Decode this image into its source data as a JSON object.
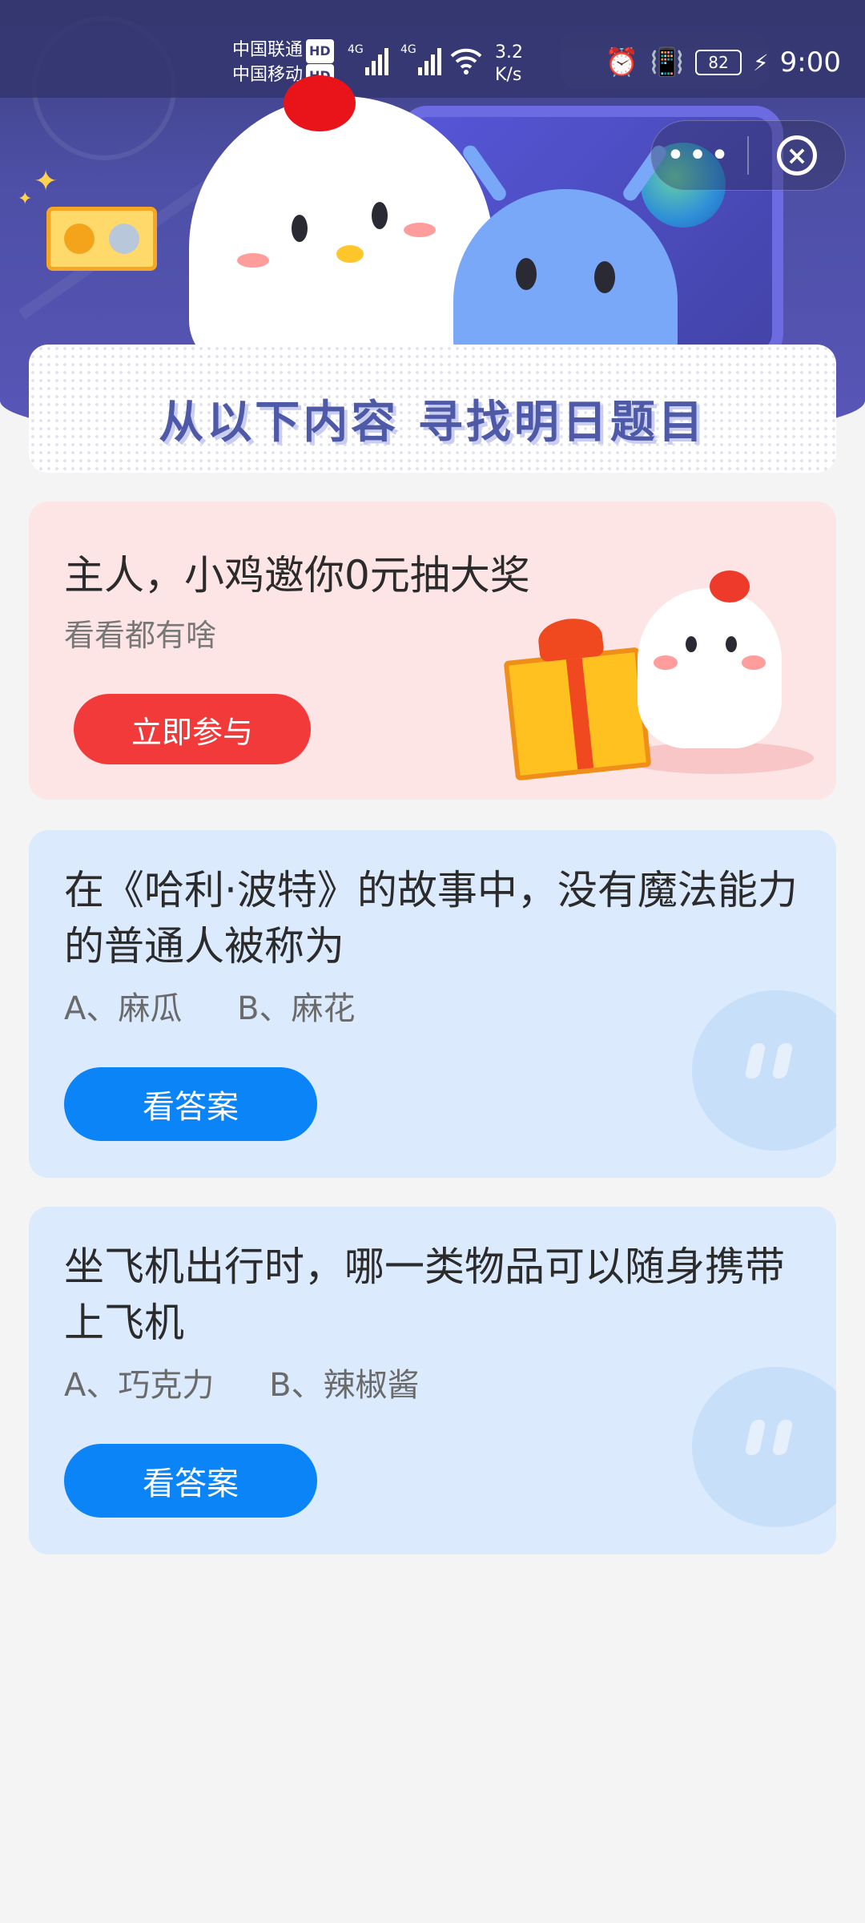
{
  "status_bar": {
    "carrier1": "中国联通",
    "carrier2": "中国移动",
    "hd": "HD",
    "net_type": "4G",
    "speed_value": "3.2",
    "speed_unit": "K/s",
    "battery": "82",
    "time": "9:00"
  },
  "header": {
    "banner_title": "从以下内容 寻找明日题目"
  },
  "promo": {
    "title": "主人，小鸡邀你0元抽大奖",
    "subtitle": "看看都有啥",
    "button_label": "立即参与"
  },
  "quiz_cards": [
    {
      "question": "在《哈利·波特》的故事中，没有魔法能力的普通人被称为",
      "option_a": "A、麻瓜",
      "option_b": "B、麻花",
      "button_label": "看答案"
    },
    {
      "question": "坐飞机出行时，哪一类物品可以随身携带上飞机",
      "option_a": "A、巧克力",
      "option_b": "B、辣椒酱",
      "button_label": "看答案"
    }
  ],
  "colors": {
    "header_bg": "#4d4fa6",
    "promo_bg": "#fde5e6",
    "promo_button": "#f23a3a",
    "quiz_bg": "#dbeafd",
    "quiz_button": "#0a84f6",
    "page_bg": "#f4f4f5"
  }
}
